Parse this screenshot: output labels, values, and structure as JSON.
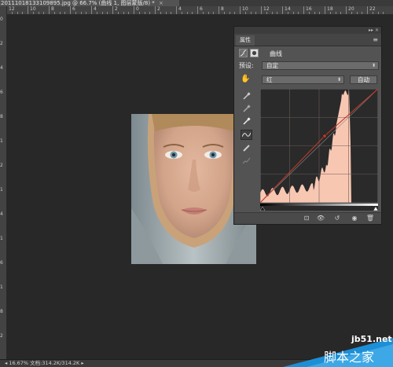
{
  "document": {
    "tab_title": "20111018133109895.jpg @ 66.7% (曲线 1, 图层蒙版/8) *",
    "close_glyph": "×"
  },
  "rulers": {
    "top_labels": [
      "12",
      "10",
      "8",
      "6",
      "4",
      "2",
      "0",
      "2",
      "4",
      "6",
      "8",
      "10",
      "12",
      "14",
      "16",
      "18",
      "20",
      "22"
    ],
    "left_labels": [
      "0",
      "2",
      "4",
      "6",
      "8",
      "1",
      "2",
      "1",
      "4",
      "1",
      "6",
      "1",
      "8",
      "2"
    ]
  },
  "panel": {
    "collapse_glyph": "▸▸",
    "close_glyph": "×",
    "tab_label": "属性",
    "menu_glyph": "≡",
    "title": "曲线",
    "preset_label": "预设:",
    "preset_value": "自定",
    "channel_value": "红",
    "auto_button": "自动",
    "tools": {
      "on_image": "✋",
      "eyedropper_black": "✎",
      "eyedropper_gray": "✎",
      "eyedropper_white": "✎",
      "curve": "∿",
      "pencil": "✐",
      "smooth": "⤳"
    },
    "bottom": {
      "clip": "⊡",
      "view_previous": "👁",
      "reset": "↺",
      "visibility": "◉",
      "delete": "🗑"
    }
  },
  "status": {
    "text": "◂ 16.67%   文档:314.2K/314.2K   ▸"
  },
  "watermark": {
    "site": "jb51.net",
    "text": "脚本之家"
  },
  "colors": {
    "histogram_fill": "#f8c7b2",
    "curve_line": "#c0392b",
    "panel_bg": "#535353",
    "canvas_bg": "#282828"
  },
  "icons": {
    "panel_header_icon": "curves-adjustment-icon",
    "mask_icon": "layer-mask-icon"
  }
}
